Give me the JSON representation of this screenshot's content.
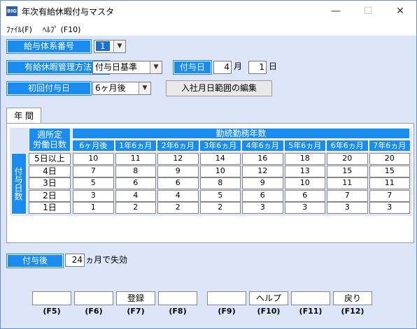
{
  "window": {
    "icon_text": "BIG",
    "title": "年次有給休暇付与マスタ",
    "minimize": "—",
    "maximize": "☐",
    "close": "✕"
  },
  "menu": {
    "file": "ﾌｧｲﾙ(F)",
    "help": "ﾍﾙﾌﾟ (F10)"
  },
  "form": {
    "salary_system_label": "給与体系番号",
    "salary_system_value": "1",
    "management_label": "有給休暇管理方法",
    "management_value": "付与日基準",
    "grant_date_label": "付与日",
    "grant_month": "4",
    "month_unit": "月",
    "grant_day": "1",
    "day_unit": "日",
    "first_grant_label": "初回付与日",
    "first_grant_value": "6ヶ月後",
    "edit_range_button": "入社月日範囲の編集",
    "expire_label": "付与後",
    "expire_months": "24",
    "expire_suffix": "ヵ月で失効"
  },
  "tab": {
    "label": "年 間"
  },
  "table": {
    "weekly_days_header": "週所定\n労働日数",
    "years_header": "勤続勤務年数",
    "grant_days_header": "付与日数",
    "columns": [
      "6ヶ月後",
      "1年6ヵ月",
      "2年6ヵ月",
      "3年6ヵ月",
      "4年6ヵ月",
      "5年6ヵ月",
      "6年6ヵ月",
      "7年6ヵ月"
    ],
    "rows": [
      {
        "label": "5日以上",
        "values": [
          "10",
          "11",
          "12",
          "14",
          "16",
          "18",
          "20",
          "20"
        ]
      },
      {
        "label": "4日",
        "values": [
          "7",
          "8",
          "9",
          "10",
          "12",
          "13",
          "15",
          "15"
        ]
      },
      {
        "label": "3日",
        "values": [
          "5",
          "6",
          "6",
          "8",
          "9",
          "10",
          "11",
          "11"
        ]
      },
      {
        "label": "2日",
        "values": [
          "3",
          "4",
          "4",
          "5",
          "6",
          "6",
          "7",
          "7"
        ]
      },
      {
        "label": "1日",
        "values": [
          "1",
          "2",
          "2",
          "2",
          "3",
          "3",
          "3",
          "3"
        ]
      }
    ]
  },
  "fkeys": [
    {
      "label": "",
      "key": "(F5)"
    },
    {
      "label": "",
      "key": "(F6)"
    },
    {
      "label": "登録",
      "key": "(F7)"
    },
    {
      "label": "",
      "key": "(F8)"
    },
    {
      "label": "",
      "key": "(F9)"
    },
    {
      "label": "ヘルプ",
      "key": "(F10)"
    },
    {
      "label": "",
      "key": "(F11)"
    },
    {
      "label": "戻り",
      "key": "(F12)"
    }
  ],
  "colors": {
    "label_bg": "#1a8cf0",
    "client_bg": "#dde5f9"
  }
}
